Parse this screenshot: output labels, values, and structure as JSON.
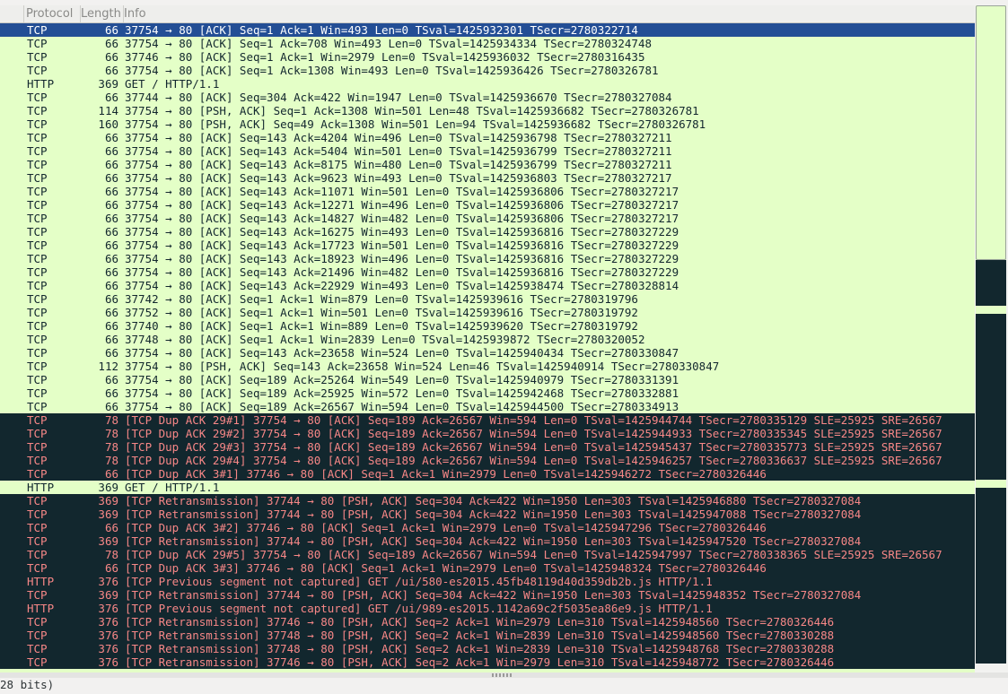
{
  "columns": {
    "no": "",
    "protocol": "Protocol",
    "length": "Length",
    "info": "Info"
  },
  "packets": [
    {
      "protocol": "TCP",
      "length": "66",
      "info": "37754 → 80 [ACK] Seq=1 Ack=1 Win=493 Len=0 TSval=1425932301 TSecr=2780322714",
      "style": "selected"
    },
    {
      "protocol": "TCP",
      "length": "66",
      "info": "37754 → 80 [ACK] Seq=1 Ack=708 Win=493 Len=0 TSval=1425934334 TSecr=2780324748",
      "style": "normal"
    },
    {
      "protocol": "TCP",
      "length": "66",
      "info": "37746 → 80 [ACK] Seq=1 Ack=1 Win=2979 Len=0 TSval=1425936032 TSecr=2780316435",
      "style": "normal"
    },
    {
      "protocol": "TCP",
      "length": "66",
      "info": "37754 → 80 [ACK] Seq=1 Ack=1308 Win=493 Len=0 TSval=1425936426 TSecr=2780326781",
      "style": "normal"
    },
    {
      "protocol": "HTTP",
      "length": "369",
      "info": "GET / HTTP/1.1",
      "style": "normal"
    },
    {
      "protocol": "TCP",
      "length": "66",
      "info": "37744 → 80 [ACK] Seq=304 Ack=422 Win=1947 Len=0 TSval=1425936670 TSecr=2780327084",
      "style": "normal"
    },
    {
      "protocol": "TCP",
      "length": "114",
      "info": "37754 → 80 [PSH, ACK] Seq=1 Ack=1308 Win=501 Len=48 TSval=1425936682 TSecr=2780326781",
      "style": "normal"
    },
    {
      "protocol": "TCP",
      "length": "160",
      "info": "37754 → 80 [PSH, ACK] Seq=49 Ack=1308 Win=501 Len=94 TSval=1425936682 TSecr=2780326781",
      "style": "normal"
    },
    {
      "protocol": "TCP",
      "length": "66",
      "info": "37754 → 80 [ACK] Seq=143 Ack=4204 Win=496 Len=0 TSval=1425936798 TSecr=2780327211",
      "style": "normal"
    },
    {
      "protocol": "TCP",
      "length": "66",
      "info": "37754 → 80 [ACK] Seq=143 Ack=5404 Win=501 Len=0 TSval=1425936799 TSecr=2780327211",
      "style": "normal"
    },
    {
      "protocol": "TCP",
      "length": "66",
      "info": "37754 → 80 [ACK] Seq=143 Ack=8175 Win=480 Len=0 TSval=1425936799 TSecr=2780327211",
      "style": "normal"
    },
    {
      "protocol": "TCP",
      "length": "66",
      "info": "37754 → 80 [ACK] Seq=143 Ack=9623 Win=493 Len=0 TSval=1425936803 TSecr=2780327217",
      "style": "normal"
    },
    {
      "protocol": "TCP",
      "length": "66",
      "info": "37754 → 80 [ACK] Seq=143 Ack=11071 Win=501 Len=0 TSval=1425936806 TSecr=2780327217",
      "style": "normal"
    },
    {
      "protocol": "TCP",
      "length": "66",
      "info": "37754 → 80 [ACK] Seq=143 Ack=12271 Win=496 Len=0 TSval=1425936806 TSecr=2780327217",
      "style": "normal"
    },
    {
      "protocol": "TCP",
      "length": "66",
      "info": "37754 → 80 [ACK] Seq=143 Ack=14827 Win=482 Len=0 TSval=1425936806 TSecr=2780327217",
      "style": "normal"
    },
    {
      "protocol": "TCP",
      "length": "66",
      "info": "37754 → 80 [ACK] Seq=143 Ack=16275 Win=493 Len=0 TSval=1425936816 TSecr=2780327229",
      "style": "normal"
    },
    {
      "protocol": "TCP",
      "length": "66",
      "info": "37754 → 80 [ACK] Seq=143 Ack=17723 Win=501 Len=0 TSval=1425936816 TSecr=2780327229",
      "style": "normal"
    },
    {
      "protocol": "TCP",
      "length": "66",
      "info": "37754 → 80 [ACK] Seq=143 Ack=18923 Win=496 Len=0 TSval=1425936816 TSecr=2780327229",
      "style": "normal"
    },
    {
      "protocol": "TCP",
      "length": "66",
      "info": "37754 → 80 [ACK] Seq=143 Ack=21496 Win=482 Len=0 TSval=1425936816 TSecr=2780327229",
      "style": "normal"
    },
    {
      "protocol": "TCP",
      "length": "66",
      "info": "37754 → 80 [ACK] Seq=143 Ack=22929 Win=493 Len=0 TSval=1425938474 TSecr=2780328814",
      "style": "normal"
    },
    {
      "protocol": "TCP",
      "length": "66",
      "info": "37742 → 80 [ACK] Seq=1 Ack=1 Win=879 Len=0 TSval=1425939616 TSecr=2780319796",
      "style": "normal"
    },
    {
      "protocol": "TCP",
      "length": "66",
      "info": "37752 → 80 [ACK] Seq=1 Ack=1 Win=501 Len=0 TSval=1425939616 TSecr=2780319792",
      "style": "normal"
    },
    {
      "protocol": "TCP",
      "length": "66",
      "info": "37740 → 80 [ACK] Seq=1 Ack=1 Win=889 Len=0 TSval=1425939620 TSecr=2780319792",
      "style": "normal"
    },
    {
      "protocol": "TCP",
      "length": "66",
      "info": "37748 → 80 [ACK] Seq=1 Ack=1 Win=2839 Len=0 TSval=1425939872 TSecr=2780320052",
      "style": "normal"
    },
    {
      "protocol": "TCP",
      "length": "66",
      "info": "37754 → 80 [ACK] Seq=143 Ack=23658 Win=524 Len=0 TSval=1425940434 TSecr=2780330847",
      "style": "normal"
    },
    {
      "protocol": "TCP",
      "length": "112",
      "info": "37754 → 80 [PSH, ACK] Seq=143 Ack=23658 Win=524 Len=46 TSval=1425940914 TSecr=2780330847",
      "style": "normal"
    },
    {
      "protocol": "TCP",
      "length": "66",
      "info": "37754 → 80 [ACK] Seq=189 Ack=25264 Win=549 Len=0 TSval=1425940979 TSecr=2780331391",
      "style": "normal"
    },
    {
      "protocol": "TCP",
      "length": "66",
      "info": "37754 → 80 [ACK] Seq=189 Ack=25925 Win=572 Len=0 TSval=1425942468 TSecr=2780332881",
      "style": "normal"
    },
    {
      "protocol": "TCP",
      "length": "66",
      "info": "37754 → 80 [ACK] Seq=189 Ack=26567 Win=594 Len=0 TSval=1425944500 TSecr=2780334913",
      "style": "normal"
    },
    {
      "protocol": "TCP",
      "length": "78",
      "info": "[TCP Dup ACK 29#1] 37754 → 80 [ACK] Seq=189 Ack=26567 Win=594 Len=0 TSval=1425944744 TSecr=2780335129 SLE=25925 SRE=26567",
      "style": "error"
    },
    {
      "protocol": "TCP",
      "length": "78",
      "info": "[TCP Dup ACK 29#2] 37754 → 80 [ACK] Seq=189 Ack=26567 Win=594 Len=0 TSval=1425944933 TSecr=2780335345 SLE=25925 SRE=26567",
      "style": "error"
    },
    {
      "protocol": "TCP",
      "length": "78",
      "info": "[TCP Dup ACK 29#3] 37754 → 80 [ACK] Seq=189 Ack=26567 Win=594 Len=0 TSval=1425945437 TSecr=2780335773 SLE=25925 SRE=26567",
      "style": "error"
    },
    {
      "protocol": "TCP",
      "length": "78",
      "info": "[TCP Dup ACK 29#4] 37754 → 80 [ACK] Seq=189 Ack=26567 Win=594 Len=0 TSval=1425946257 TSecr=2780336637 SLE=25925 SRE=26567",
      "style": "error"
    },
    {
      "protocol": "TCP",
      "length": "66",
      "info": "[TCP Dup ACK 3#1] 37746 → 80 [ACK] Seq=1 Ack=1 Win=2979 Len=0 TSval=1425946272 TSecr=2780326446",
      "style": "error"
    },
    {
      "protocol": "HTTP",
      "length": "369",
      "info": "GET / HTTP/1.1",
      "style": "normal"
    },
    {
      "protocol": "TCP",
      "length": "369",
      "info": "[TCP Retransmission] 37744 → 80 [PSH, ACK] Seq=304 Ack=422 Win=1950 Len=303 TSval=1425946880 TSecr=2780327084",
      "style": "error"
    },
    {
      "protocol": "TCP",
      "length": "369",
      "info": "[TCP Retransmission] 37744 → 80 [PSH, ACK] Seq=304 Ack=422 Win=1950 Len=303 TSval=1425947088 TSecr=2780327084",
      "style": "error"
    },
    {
      "protocol": "TCP",
      "length": "66",
      "info": "[TCP Dup ACK 3#2] 37746 → 80 [ACK] Seq=1 Ack=1 Win=2979 Len=0 TSval=1425947296 TSecr=2780326446",
      "style": "error"
    },
    {
      "protocol": "TCP",
      "length": "369",
      "info": "[TCP Retransmission] 37744 → 80 [PSH, ACK] Seq=304 Ack=422 Win=1950 Len=303 TSval=1425947520 TSecr=2780327084",
      "style": "error"
    },
    {
      "protocol": "TCP",
      "length": "78",
      "info": "[TCP Dup ACK 29#5] 37754 → 80 [ACK] Seq=189 Ack=26567 Win=594 Len=0 TSval=1425947997 TSecr=2780338365 SLE=25925 SRE=26567",
      "style": "error"
    },
    {
      "protocol": "TCP",
      "length": "66",
      "info": "[TCP Dup ACK 3#3] 37746 → 80 [ACK] Seq=1 Ack=1 Win=2979 Len=0 TSval=1425948324 TSecr=2780326446",
      "style": "error"
    },
    {
      "protocol": "HTTP",
      "length": "376",
      "info": "[TCP Previous segment not captured] GET /ui/580-es2015.45fb48119d40d359db2b.js HTTP/1.1",
      "style": "error"
    },
    {
      "protocol": "TCP",
      "length": "369",
      "info": "[TCP Retransmission] 37744 → 80 [PSH, ACK] Seq=304 Ack=422 Win=1950 Len=303 TSval=1425948352 TSecr=2780327084",
      "style": "error"
    },
    {
      "protocol": "HTTP",
      "length": "376",
      "info": "[TCP Previous segment not captured] GET /ui/989-es2015.1142a69c2f5035ea86e9.js HTTP/1.1",
      "style": "error"
    },
    {
      "protocol": "TCP",
      "length": "376",
      "info": "[TCP Retransmission] 37746 → 80 [PSH, ACK] Seq=2 Ack=1 Win=2979 Len=310 TSval=1425948560 TSecr=2780326446",
      "style": "error"
    },
    {
      "protocol": "TCP",
      "length": "376",
      "info": "[TCP Retransmission] 37748 → 80 [PSH, ACK] Seq=2 Ack=1 Win=2839 Len=310 TSval=1425948560 TSecr=2780330288",
      "style": "error"
    },
    {
      "protocol": "TCP",
      "length": "376",
      "info": "[TCP Retransmission] 37748 → 80 [PSH, ACK] Seq=2 Ack=1 Win=2839 Len=310 TSval=1425948768 TSecr=2780330288",
      "style": "error"
    },
    {
      "protocol": "TCP",
      "length": "376",
      "info": "[TCP Retransmission] 37746 → 80 [PSH, ACK] Seq=2 Ack=1 Win=2979 Len=310 TSval=1425948772 TSecr=2780326446",
      "style": "error"
    }
  ],
  "status": {
    "bits_text": "28 bits)"
  },
  "colors": {
    "normal_bg": "#e4ffc7",
    "normal_fg": "#12272e",
    "error_bg": "#12272e",
    "error_fg": "#f78787",
    "selected_bg": "#234e95",
    "selected_fg": "#ffffff"
  }
}
